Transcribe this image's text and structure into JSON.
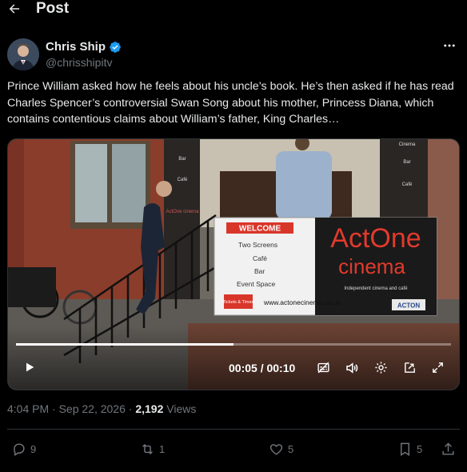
{
  "header": {
    "title": "Post"
  },
  "author": {
    "name": "Chris Ship",
    "handle": "@chrisshipitv"
  },
  "tweet": {
    "text": "Prince William asked how he feels about his uncle’s book. He’s then asked if he has read Charles Spencer’s controversial Swan Song about his mother, Princess Diana, which contains contentious claims about William’s father, King Charles…"
  },
  "video": {
    "time_display": "00:05 / 00:10",
    "progress": 0.5,
    "sign": {
      "welcome": "WELCOME",
      "items": [
        "Two Screens",
        "Café",
        "Bar",
        "Event Space"
      ],
      "tickets": "Tickets & Times",
      "url": "www.actonecinema.co.uk",
      "brand_line1": "ActOne",
      "brand_line2": "cinema",
      "tagline": "Independent cinema and café",
      "logo": "ACTON"
    },
    "window_labels": [
      "Bar",
      "Café",
      "ActOne cinema",
      "Cinema",
      "Bar",
      "Café"
    ]
  },
  "meta": {
    "time": "4:04 PM · Sep 22, 2026 · ",
    "views_count": "2,192",
    "views_label": " Views"
  },
  "actions": {
    "replies": "9",
    "reposts": "1",
    "likes": "5",
    "bookmarks": "5"
  },
  "colors": {
    "background": "#000000",
    "text": "#e7e9ea",
    "muted": "#71767b",
    "verified": "#1d9bf0",
    "divider": "#2f3336"
  }
}
